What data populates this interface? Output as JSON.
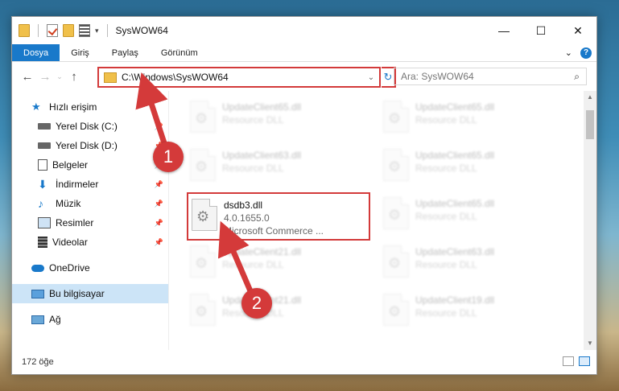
{
  "window": {
    "title": "SysWOW64",
    "minimize_label": "—",
    "maximize_label": "☐",
    "close_label": "✕"
  },
  "ribbon": {
    "tabs": [
      "Dosya",
      "Giriş",
      "Paylaş",
      "Görünüm"
    ],
    "expand_label": "⌄",
    "help_label": "?"
  },
  "nav": {
    "back": "←",
    "forward": "→",
    "up": "↑",
    "address": "C:\\Windows\\SysWOW64",
    "refresh": "↻",
    "search_placeholder": "Ara: SysWOW64"
  },
  "sidebar": {
    "items": [
      {
        "label": "Hızlı erişim",
        "icon": "star-icon"
      },
      {
        "label": "Yerel Disk (C:)",
        "icon": "drive-icon",
        "pinned": true
      },
      {
        "label": "Yerel Disk (D:)",
        "icon": "drive-icon",
        "pinned": true
      },
      {
        "label": "Belgeler",
        "icon": "documents-icon",
        "pinned": true
      },
      {
        "label": "İndirmeler",
        "icon": "download-icon",
        "pinned": true
      },
      {
        "label": "Müzik",
        "icon": "music-icon",
        "pinned": true
      },
      {
        "label": "Resimler",
        "icon": "pictures-icon",
        "pinned": true
      },
      {
        "label": "Videolar",
        "icon": "videos-icon",
        "pinned": true
      },
      {
        "label": "OneDrive",
        "icon": "cloud-icon"
      },
      {
        "label": "Bu bilgisayar",
        "icon": "computer-icon",
        "selected": true
      },
      {
        "label": "Ağ",
        "icon": "network-icon"
      }
    ]
  },
  "files": [
    {
      "name": "UpdateClient65.dll",
      "desc": "Resource DLL"
    },
    {
      "name": "UpdateClient65.dll",
      "desc": "Resource DLL"
    },
    {
      "name": "UpdateClient63.dll",
      "desc": "Resource DLL"
    },
    {
      "name": "UpdateClient65.dll",
      "desc": "Resource DLL"
    },
    {
      "name": "dsdb3.dll",
      "version": "4.0.1655.0",
      "company": "Microsoft Commerce ..."
    },
    {
      "name": "UpdateClient65.dll",
      "desc": "Resource DLL"
    },
    {
      "name": "UpdateClient21.dll",
      "desc": "Resource DLL"
    },
    {
      "name": "UpdateClient63.dll",
      "desc": "Resource DLL"
    },
    {
      "name": "UpdateClient21.dll",
      "desc": "Resource DLL"
    },
    {
      "name": "UpdateClient19.dll",
      "desc": "Resource DLL"
    }
  ],
  "status": {
    "count": "172 öğe"
  },
  "annotations": {
    "badge1": "1",
    "badge2": "2"
  },
  "colors": {
    "accent": "#1979ca",
    "highlight": "#d33a3a"
  }
}
